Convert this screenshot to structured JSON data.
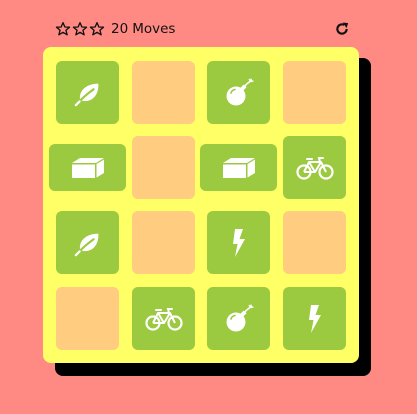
{
  "moves": {
    "count": "20",
    "label": "Moves"
  },
  "stars": {
    "earned": 0,
    "total": 3
  },
  "colors": {
    "page_background": "#ff8a84",
    "deck_background": "#ffff66",
    "card_closed": "#ffcc80",
    "card_matched": "#9bc93f",
    "icon": "#ffffff"
  },
  "restart_icon": "redo-icon",
  "cards": [
    {
      "icon": "leaf-icon",
      "state": "matched"
    },
    {
      "icon": "",
      "state": "closed"
    },
    {
      "icon": "bomb-icon",
      "state": "matched"
    },
    {
      "icon": "",
      "state": "closed"
    },
    {
      "icon": "cube-icon",
      "state": "matched"
    },
    {
      "icon": "",
      "state": "closed"
    },
    {
      "icon": "cube-icon",
      "state": "matched"
    },
    {
      "icon": "bicycle-icon",
      "state": "matched"
    },
    {
      "icon": "leaf-icon",
      "state": "matched"
    },
    {
      "icon": "",
      "state": "closed"
    },
    {
      "icon": "bolt-icon",
      "state": "matched"
    },
    {
      "icon": "",
      "state": "closed"
    },
    {
      "icon": "",
      "state": "closed"
    },
    {
      "icon": "bicycle-icon",
      "state": "matched"
    },
    {
      "icon": "bomb-icon",
      "state": "matched"
    },
    {
      "icon": "bolt-icon",
      "state": "matched"
    }
  ]
}
